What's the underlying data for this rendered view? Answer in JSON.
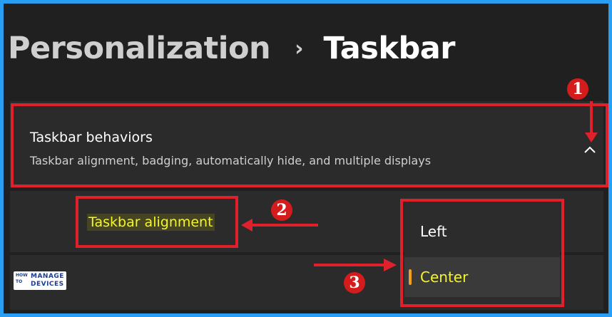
{
  "breadcrumb": {
    "parent": "Personalization",
    "separator": "›",
    "current": "Taskbar"
  },
  "section": {
    "title": "Taskbar behaviors",
    "description": "Taskbar alignment, badging, automatically hide, and multiple displays",
    "expand_icon": "chevron-up-icon"
  },
  "setting": {
    "label": "Taskbar alignment"
  },
  "dropdown": {
    "options": [
      "Left",
      "Center"
    ],
    "selected": "Center"
  },
  "annotations": {
    "step1": "1",
    "step2": "2",
    "step3": "3",
    "color": "#e0202a"
  },
  "logo": {
    "line1": "HOW",
    "line2": "TO",
    "line3": "MANAGE",
    "line4": "DEVICES"
  },
  "colors": {
    "highlight_text": "#f5f529",
    "accent_indicator": "#f0a020",
    "border_frame": "#2a9df4"
  }
}
